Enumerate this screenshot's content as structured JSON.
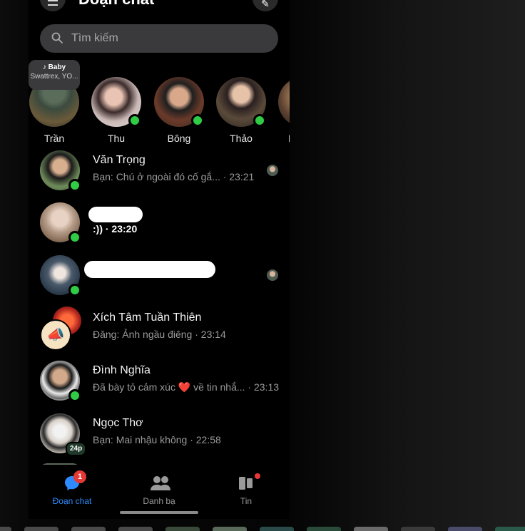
{
  "header": {
    "title": "Đoạn chat"
  },
  "search": {
    "placeholder": "Tìm kiếm"
  },
  "note": {
    "title": "Baby",
    "subtitle": "Swattrex, YO..."
  },
  "stories": [
    {
      "name": "Trần",
      "online": false
    },
    {
      "name": "Thu",
      "online": true
    },
    {
      "name": "Bông",
      "online": true
    },
    {
      "name": "Thảo",
      "online": true
    },
    {
      "name": "N",
      "online": false
    }
  ],
  "chats": [
    {
      "name": "Văn Trọng",
      "preview": "Bạn: Chú ở ngoài đó cố gắ... · 23:21",
      "online": true
    },
    {
      "name": "",
      "preview": ":)) · 23:20",
      "online": true
    },
    {
      "name": "",
      "preview": "",
      "online": true
    },
    {
      "name": "Xích Tâm Tuần Thiên",
      "preview": "Đăng: Ảnh ngầu điêng · 23:14",
      "online": false
    },
    {
      "name": "Đình Nghĩa",
      "preview_before": "Đã bày tỏ cảm xúc ",
      "preview_emoji": "❤️",
      "preview_after": " về tin nhắ... · 23:13",
      "online": true
    },
    {
      "name": "Ngọc Thơ",
      "preview": "Bạn: Mai nhậu không · 22:58",
      "online": false,
      "badge": "24p"
    }
  ],
  "nav": {
    "chats_label": "Đoạn chat",
    "chats_badge": "1",
    "contacts_label": "Danh bạ",
    "stories_label": "Tin"
  },
  "colors": {
    "accent": "#2e8bff",
    "online": "#31cc46",
    "badge": "#e53935"
  }
}
